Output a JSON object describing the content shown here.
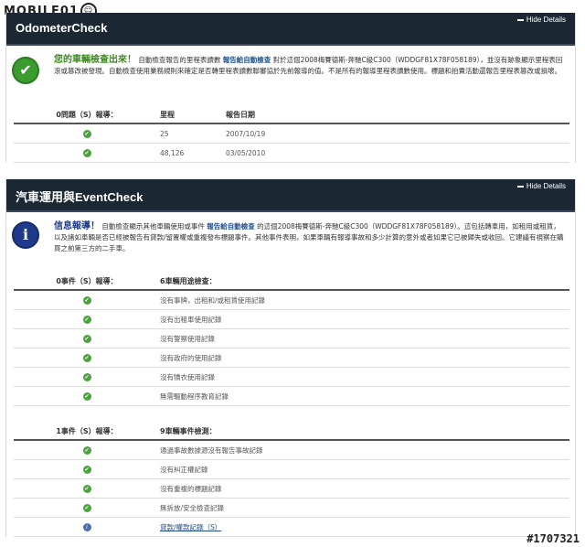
{
  "logo": {
    "text": "MOBILE01"
  },
  "watermark": "#1707321",
  "odometer": {
    "title": "OdometerCheck",
    "hide_label": "Hide Details",
    "headline": "您的車輛檢查出來！",
    "intro_a": "自動檢查報告的里程表讀數",
    "intro_link": "報告給自動檢查",
    "intro_b": "對於這個2008梅賽德斯-奔馳C級C300（WDDGF81X78F058189），並沒有跡象顯示里程表回滾或篡改被發現。自動檢查使用業務規則來確定是否轉里程表讀數聯審協於先前報導的值。不是所有的報導里程表讀數使用。標題和拍賣活動還報告里程表篡改或損壞。",
    "table": {
      "col1": "0問題（S）報導：",
      "col2": "里程",
      "col3": "報告日期",
      "rows": [
        {
          "mileage": "25",
          "date": "2007/10/19"
        },
        {
          "mileage": "48,126",
          "date": "03/05/2010"
        }
      ]
    }
  },
  "event": {
    "title": "汽車運用與EventCheck",
    "hide_label": "Hide Details",
    "headline": "信息報導！",
    "intro_a": "自動檢查顯示其他車輛使用或事件",
    "intro_link": "報告給自動檢查",
    "intro_b": "的這個2008梅賽德斯-奔馳C級C300（WDDGF81X78F058189）。這包括轉車用，如租用或租賃，以及諸如車輛是否已經被報告有貸款/留置權或重複發布標題事件。其他事件表明，如果車輛有報導事故和多少計算的意外或者如果它已被歸失或收回。它建議有視察在購買之前第三方的二手車。",
    "table1": {
      "col1": "0事件（S）報導：",
      "col2": "6車輛用途檢查：",
      "rows": [
        "沒有事牌，出租和/或租賃使用記錄",
        "沒有出租車使用記錄",
        "沒有警察使用記錄",
        "沒有政府的使用記錄",
        "沒有犢衣使用記錄",
        "無需驅動程序教育記錄"
      ]
    },
    "table2": {
      "col1": "1事件（S）報導：",
      "col2": "9車輛事件檢測：",
      "rows": [
        "通過事故數據源沒有報告事故記錄",
        "沒有糾正權記錄",
        "沒有重複的標題記錄",
        "無拆放/安全檢查記錄"
      ],
      "info_row": "貸款/權款記錄（S）"
    }
  }
}
